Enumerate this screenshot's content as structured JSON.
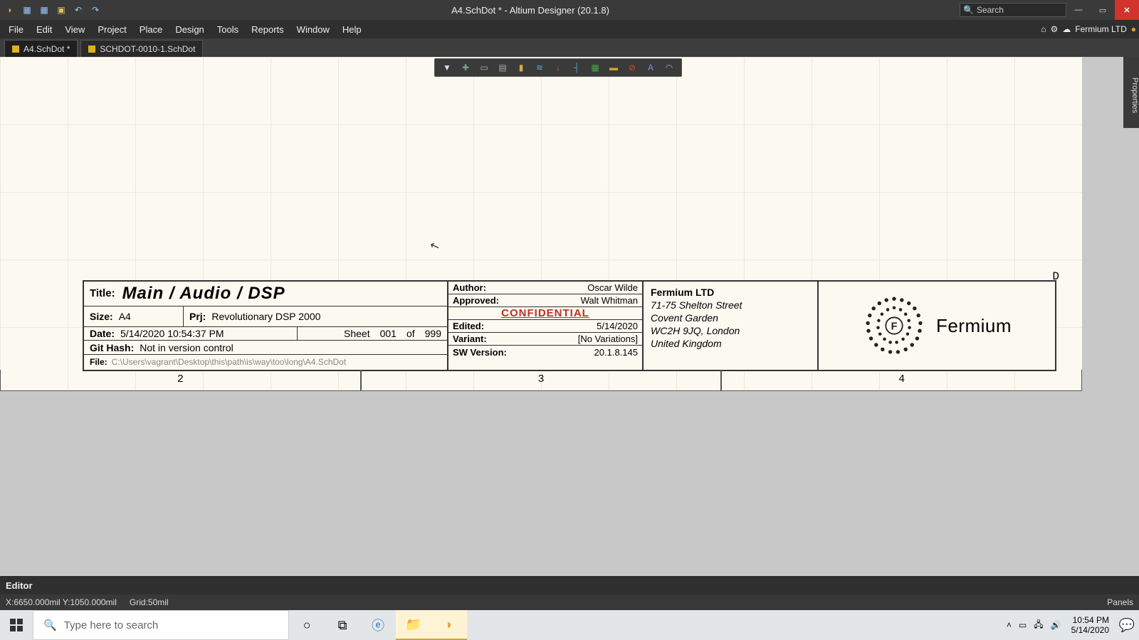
{
  "titlebar": {
    "title": "A4.SchDot * - Altium Designer (20.1.8)",
    "search_placeholder": "Search"
  },
  "menubar": {
    "items": [
      "File",
      "Edit",
      "View",
      "Project",
      "Place",
      "Design",
      "Tools",
      "Reports",
      "Window",
      "Help"
    ],
    "user_label": "Fermium LTD"
  },
  "tabs": [
    {
      "label": "A4.SchDot *",
      "active": true
    },
    {
      "label": "SCHDOT-0010-1.SchDot",
      "active": false
    }
  ],
  "side_panel": "Properties",
  "row_marker": "D",
  "ruler": [
    "2",
    "3",
    "4"
  ],
  "titleblock": {
    "title_label": "Title:",
    "title_value": "Main / Audio / DSP",
    "size_label": "Size:",
    "size_value": "A4",
    "prj_label": "Prj:",
    "prj_value": "Revolutionary DSP 2000",
    "date_label": "Date:",
    "date_value": "5/14/2020  10:54:37 PM",
    "sheet_label": "Sheet",
    "sheet_cur": "001",
    "sheet_of": "of",
    "sheet_tot": "999",
    "git_label": "Git Hash:",
    "git_value": "Not in version control",
    "file_label": "File:",
    "file_value": "C:\\Users\\vagrant\\Desktop\\this\\path\\is\\way\\too\\long\\A4.SchDot",
    "author_label": "Author:",
    "author_value": "Oscar Wilde",
    "approved_label": "Approved:",
    "approved_value": "Walt Whitman",
    "confidential": "CONFIDENTIAL",
    "edited_label": "Edited:",
    "edited_value": "5/14/2020",
    "variant_label": "Variant:",
    "variant_value": "[No Variations]",
    "swver_label": "SW Version:",
    "swver_value": "20.1.8.145",
    "company_name": "Fermium LTD",
    "addr1": "71-75 Shelton Street",
    "addr2": "Covent Garden",
    "addr3": "WC2H 9JQ, London",
    "addr4": "United Kingdom",
    "logo_text": "Fermium"
  },
  "editor_label": "Editor",
  "status": {
    "coords": "X:6650.000mil Y:1050.000mil",
    "grid": "Grid:50mil",
    "panels": "Panels"
  },
  "taskbar": {
    "search_placeholder": "Type here to search",
    "clock_time": "10:54 PM",
    "clock_date": "5/14/2020"
  }
}
